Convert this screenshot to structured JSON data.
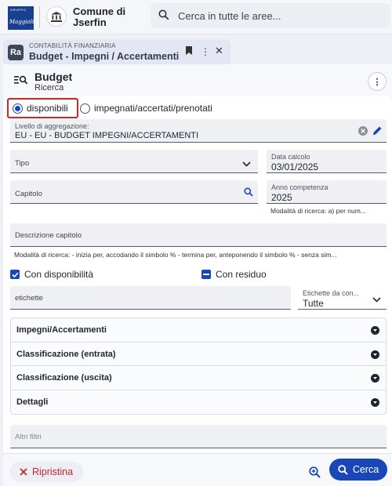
{
  "header": {
    "logo_top": "GRUPPO",
    "logo_brand": "Maggioli",
    "comune_name": "Comune di Jserfin",
    "search_placeholder": "Cerca in tutte le aree..."
  },
  "tab": {
    "section": "CONTABILITÀ FINANZIARIA",
    "title": "Budget - Impegni / Accertamenti",
    "icon_text": "Ra"
  },
  "panel": {
    "title": "Budget",
    "subtitle": "Ricerca"
  },
  "radios": [
    {
      "label": "disponibili",
      "selected": true
    },
    {
      "label": "impegnati/accertati/prenotati",
      "selected": false
    }
  ],
  "fields": {
    "livello_label": "Livello di aggregazione:",
    "livello_value": "EU - EU - BUDGET IMPEGNI/ACCERTAMENTI",
    "tipo_placeholder": "Tipo",
    "data_calcolo_label": "Data calcolo",
    "data_calcolo_value": "03/01/2025",
    "capitolo_placeholder": "Capitolo",
    "anno_label": "Anno competenza",
    "anno_value": "2025",
    "anno_hint": "Modalità di ricerca: a) per num...",
    "descrizione_placeholder": "Descrizione capitolo",
    "descrizione_hint": "Modalità di ricerca: - inizia per, accodando il simbolo % - termina per, anteponendo il simbolo % - senza sim...",
    "etichette_placeholder": "etichette",
    "etichette_con_label": "Etichette da con...",
    "etichette_con_value": "Tutte",
    "altri_filtri_placeholder": "Altri filtri"
  },
  "checkboxes": [
    {
      "label": "Con disponibilità",
      "state": "checked"
    },
    {
      "label": "Con residuo",
      "state": "indeterminate"
    }
  ],
  "accordion": [
    "Impegni/Accertamenti",
    "Classificazione (entrata)",
    "Classificazione (uscita)",
    "Dettagli"
  ],
  "footer": {
    "reset_label": "Ripristina",
    "search_label": "Cerca"
  },
  "colors": {
    "primary": "#1a47b8",
    "danger": "#c0262c",
    "highlight": "#e02020"
  }
}
